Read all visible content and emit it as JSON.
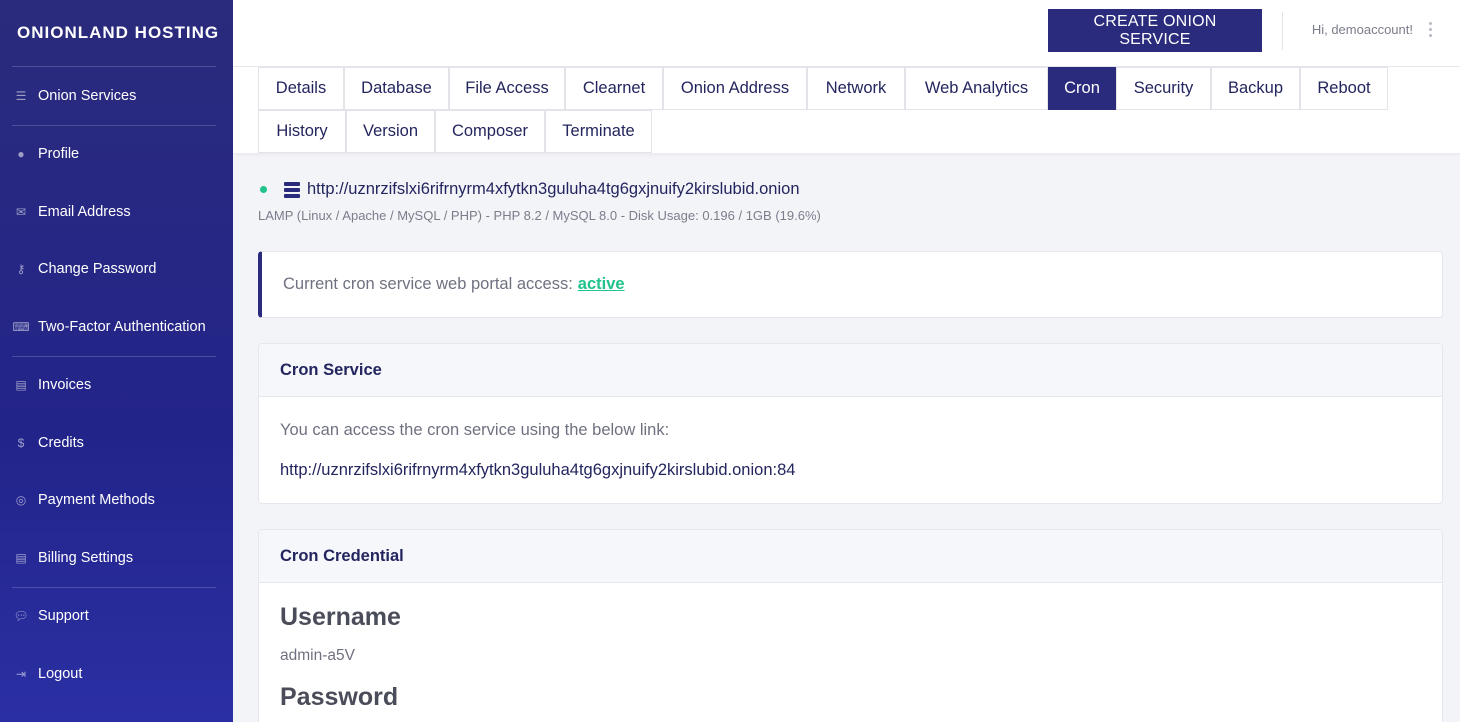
{
  "brand": "ONIONLAND HOSTING",
  "sidebar": {
    "items": [
      {
        "label": "Onion Services",
        "icon": "server-icon"
      },
      {
        "label": "Profile",
        "icon": "user-icon"
      },
      {
        "label": "Email Address",
        "icon": "email-icon"
      },
      {
        "label": "Change Password",
        "icon": "key-icon"
      },
      {
        "label": "Two-Factor Authentication",
        "icon": "keyboard-icon"
      },
      {
        "label": "Invoices",
        "icon": "file-invoice-icon"
      },
      {
        "label": "Credits",
        "icon": "dollar-icon"
      },
      {
        "label": "Payment Methods",
        "icon": "coins-icon"
      },
      {
        "label": "Billing Settings",
        "icon": "file-icon"
      },
      {
        "label": "Support",
        "icon": "comments-icon"
      },
      {
        "label": "Logout",
        "icon": "sign-out-icon"
      }
    ]
  },
  "header": {
    "create_button": "CREATE ONION SERVICE",
    "greeting": "Hi, demoaccount!"
  },
  "tabs": [
    {
      "label": "Details"
    },
    {
      "label": "Database"
    },
    {
      "label": "File Access"
    },
    {
      "label": "Clearnet"
    },
    {
      "label": "Onion Address"
    },
    {
      "label": "Network"
    },
    {
      "label": "Web Analytics"
    },
    {
      "label": "Cron",
      "active": true
    },
    {
      "label": "Security"
    },
    {
      "label": "Backup"
    },
    {
      "label": "Reboot"
    },
    {
      "label": "History"
    },
    {
      "label": "Version"
    },
    {
      "label": "Composer"
    },
    {
      "label": "Terminate"
    }
  ],
  "service": {
    "url": "http://uznrzifslxi6rifrnyrm4xfytkn3guluha4tg6gxjnuify2kirslubid.onion",
    "info": "LAMP (Linux / Apache / MySQL / PHP) - PHP 8.2 / MySQL 8.0 - Disk Usage: 0.196 / 1GB (19.6%)",
    "status_color": "#20c38a"
  },
  "alert": {
    "text": "Current cron service web portal access:",
    "status": "active"
  },
  "cron_service": {
    "title": "Cron Service",
    "description": "You can access the cron service using the below link:",
    "link": "http://uznrzifslxi6rifrnyrm4xfytkn3guluha4tg6gxjnuify2kirslubid.onion:84"
  },
  "cron_credential": {
    "title": "Cron Credential",
    "username_label": "Username",
    "username": "admin-a5V",
    "password_label": "Password"
  },
  "colors": {
    "primary": "#2a2b7c",
    "accent": "#20c38a"
  }
}
